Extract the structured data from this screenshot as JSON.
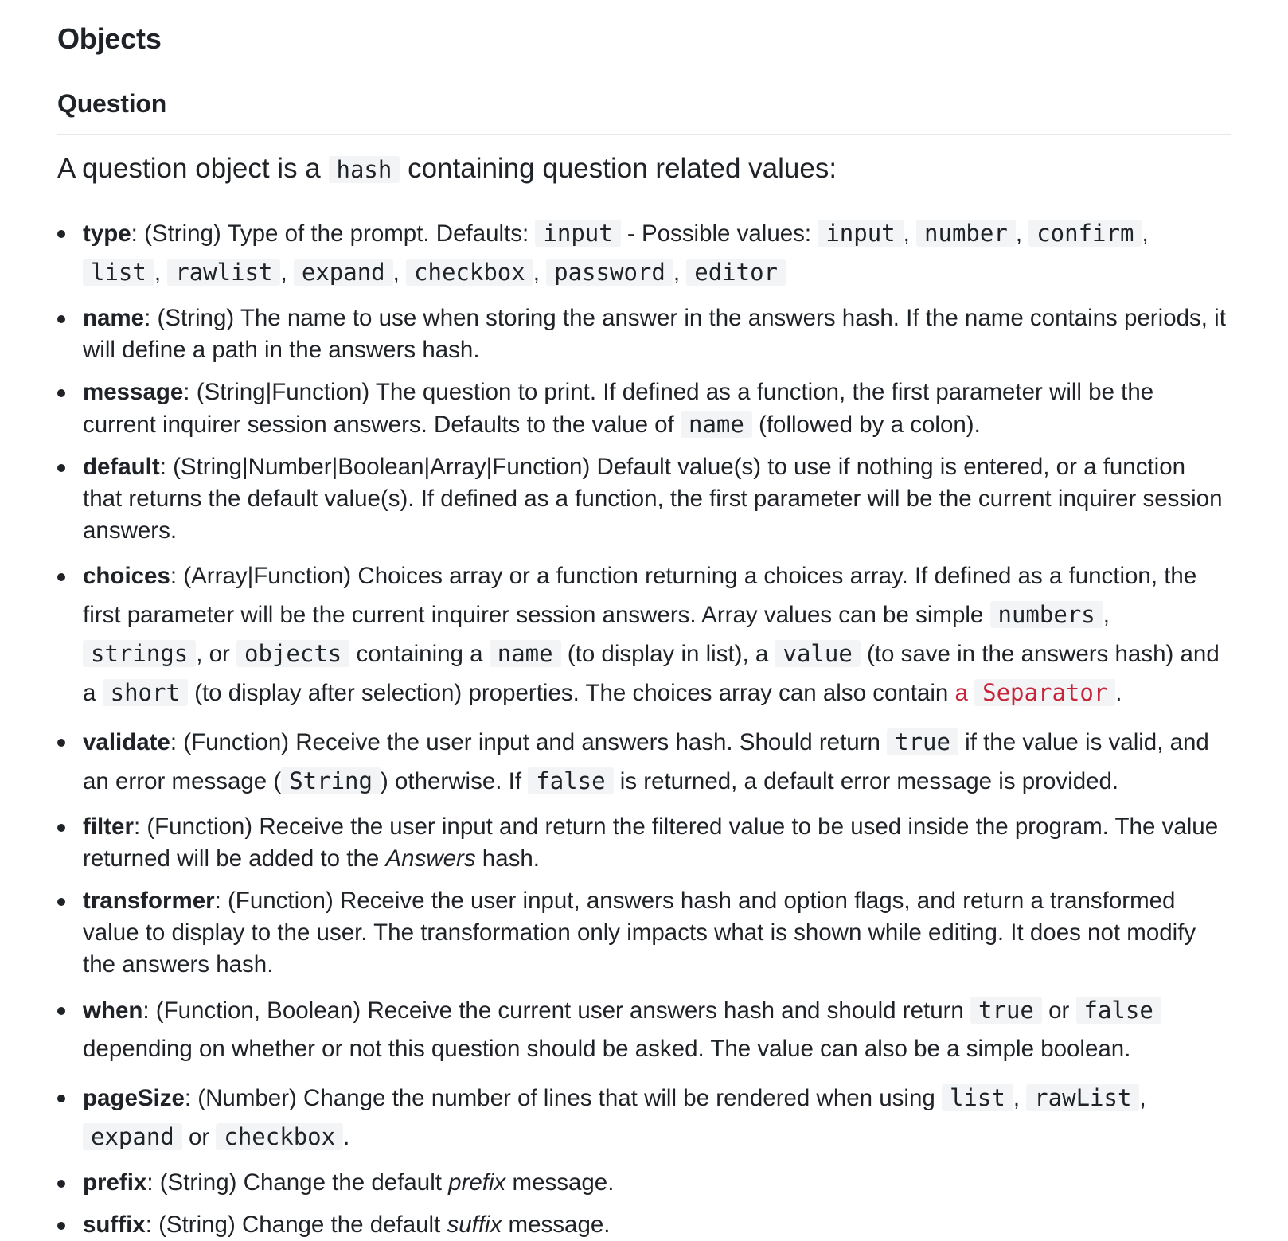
{
  "heading": "Objects",
  "subheading": "Question",
  "intro": {
    "before": "A question object is a ",
    "code": "hash",
    "after": " containing question related values:"
  },
  "items": {
    "type": {
      "name": "type",
      "t1": ": (String) Type of the prompt. Defaults: ",
      "c1": "input",
      "t2": " - Possible values: ",
      "c2": "input",
      "t3": ", ",
      "c3": "number",
      "t4": ", ",
      "c4": "confirm",
      "t5": ", ",
      "c5": "list",
      "t6": ", ",
      "c6": "rawlist",
      "t7": ", ",
      "c7": "expand",
      "t8": ", ",
      "c8": "checkbox",
      "t9": ", ",
      "c9": "password",
      "t10": ", ",
      "c10": "editor"
    },
    "name": {
      "name": "name",
      "t1": ": (String) The name to use when storing the answer in the answers hash. If the name contains periods, it will define a path in the answers hash."
    },
    "message": {
      "name": "message",
      "t1": ": (String|Function) The question to print. If defined as a function, the first parameter will be the current inquirer session answers. Defaults to the value of ",
      "c1": "name",
      "t2": " (followed by a colon)."
    },
    "default": {
      "name": "default",
      "t1": ": (String|Number|Boolean|Array|Function) Default value(s) to use if nothing is entered, or a function that returns the default value(s). If defined as a function, the first parameter will be the current inquirer session answers."
    },
    "choices": {
      "name": "choices",
      "t1": ": (Array|Function) Choices array or a function returning a choices array. If defined as a function, the first parameter will be the current inquirer session answers. Array values can be simple ",
      "c1": "numbers",
      "t2": ", ",
      "c2": "strings",
      "t3": ", or ",
      "c3": "objects",
      "t4": " containing a ",
      "c4": "name",
      "t5": " (to display in list), a ",
      "c5": "value",
      "t6": " (to save in the answers hash) and a ",
      "c6": "short",
      "t7": " (to display after selection) properties. The choices array can also contain ",
      "link_text": "a ",
      "link_code": "Separator",
      "t8": "."
    },
    "validate": {
      "name": "validate",
      "t1": ": (Function) Receive the user input and answers hash. Should return ",
      "c1": "true",
      "t2": " if the value is valid, and an error message (",
      "c2": "String",
      "t3": ") otherwise. If ",
      "c3": "false",
      "t4": " is returned, a default error message is provided."
    },
    "filter": {
      "name": "filter",
      "t1": ": (Function) Receive the user input and return the filtered value to be used inside the program. The value returned will be added to the ",
      "em": "Answers",
      "t2": " hash."
    },
    "transformer": {
      "name": "transformer",
      "t1": ": (Function) Receive the user input, answers hash and option flags, and return a transformed value to display to the user. The transformation only impacts what is shown while editing. It does not modify the answers hash."
    },
    "when": {
      "name": "when",
      "t1": ": (Function, Boolean) Receive the current user answers hash and should return ",
      "c1": "true",
      "t2": " or ",
      "c2": "false",
      "t3": " depending on whether or not this question should be asked. The value can also be a simple boolean."
    },
    "pageSize": {
      "name": "pageSize",
      "t1": ": (Number) Change the number of lines that will be rendered when using ",
      "c1": "list",
      "t2": ", ",
      "c2": "rawList",
      "t3": ", ",
      "c3": "expand",
      "t4": " or ",
      "c4": "checkbox",
      "t5": "."
    },
    "prefix": {
      "name": "prefix",
      "t1": ": (String) Change the default ",
      "em": "prefix",
      "t2": " message."
    },
    "suffix": {
      "name": "suffix",
      "t1": ": (String) Change the default ",
      "em": "suffix",
      "t2": " message."
    }
  }
}
